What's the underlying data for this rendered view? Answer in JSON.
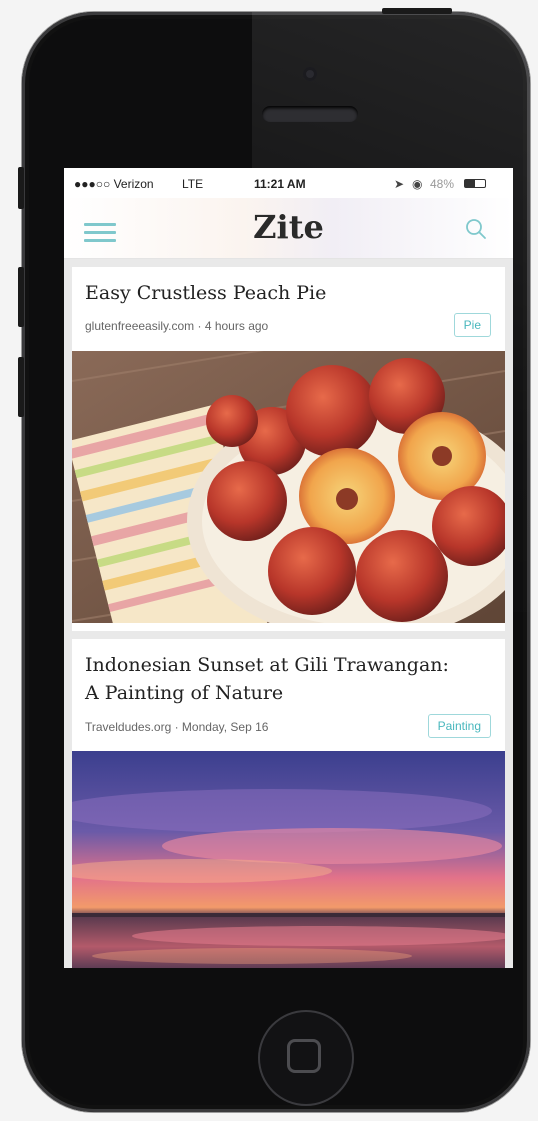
{
  "status_bar": {
    "carrier": "●●●○○ Verizon",
    "network": "LTE",
    "time": "11:21 AM",
    "battery": "48%"
  },
  "nav": {
    "title": "Zite",
    "menu_icon": "hamburger-menu-icon",
    "search_icon": "search-icon"
  },
  "articles": [
    {
      "title": "Easy Crustless Peach Pie",
      "source": "glutenfreeeasily.com · 4 hours ago",
      "tag": "Pie",
      "image": "peaches-in-bowl-photo"
    },
    {
      "title_line1": "Indonesian Sunset at Gili Trawangan:",
      "title_line2": "A Painting of Nature",
      "source": "Traveldudes.org · Monday, Sep 16",
      "tag": "Painting",
      "image": "sunset-over-water-photo"
    }
  ],
  "colors": {
    "accent": "#48b7bd",
    "phone_body": "#0d0d0e"
  }
}
